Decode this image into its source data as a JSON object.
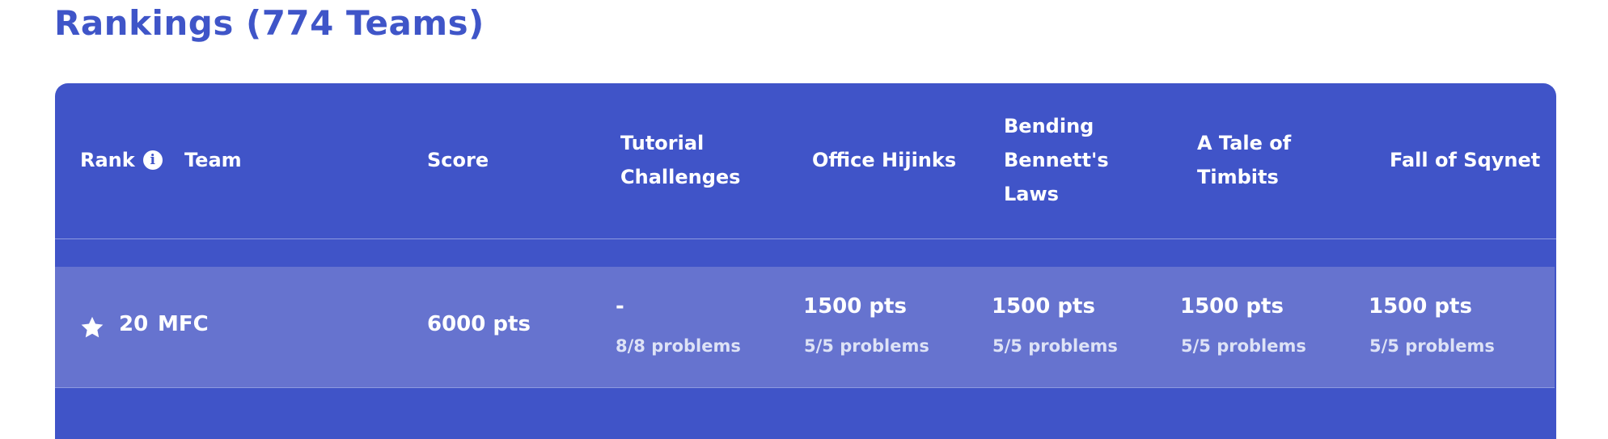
{
  "page": {
    "title": "Rankings (774 Teams)"
  },
  "table": {
    "headers": {
      "rank": "Rank",
      "team": "Team",
      "score": "Score",
      "challenges": [
        "Tutorial Challenges",
        "Office Hijinks",
        "Bending Bennett's Laws",
        "A Tale of Timbits",
        "Fall of Sqynet"
      ]
    },
    "rows": [
      {
        "starred": true,
        "rank": "20",
        "team": "MFC",
        "score": "6000 pts",
        "challenges": [
          {
            "points": "-",
            "problems": "8/8 problems"
          },
          {
            "points": "1500 pts",
            "problems": "5/5 problems"
          },
          {
            "points": "1500 pts",
            "problems": "5/5 problems"
          },
          {
            "points": "1500 pts",
            "problems": "5/5 problems"
          },
          {
            "points": "1500 pts",
            "problems": "5/5 problems"
          }
        ]
      }
    ]
  },
  "icons": {
    "rank_info": "info-icon",
    "favorite": "star-icon"
  },
  "colors": {
    "accent": "#3f55c8",
    "table_bg": "#4054c8",
    "row_bg": "#6673cf"
  }
}
